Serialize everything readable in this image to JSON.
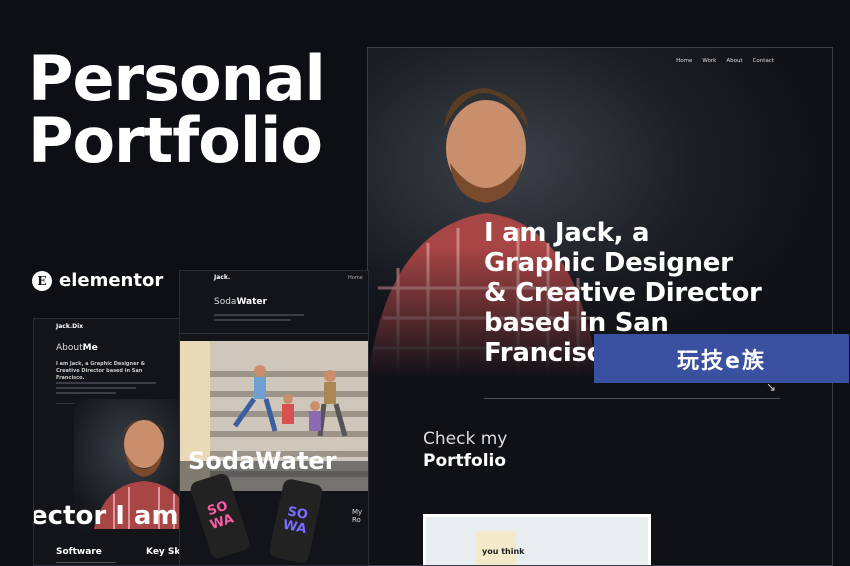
{
  "headline": {
    "line1": "Personal",
    "line2": "Portfolio"
  },
  "elementor": {
    "icon_glyph": "E",
    "label": "elementor"
  },
  "card_about": {
    "logo": "Jack.Dix",
    "title_light": "About",
    "title_bold": "Me",
    "blurb": "I am Jack, a Graphic Designer & Creative Director based in San Francisco.",
    "ghost_text": "ector I am",
    "section_left": "Software",
    "section_right": "Key Sk"
  },
  "card_soda": {
    "logo": "Jack.",
    "nav_home": "Home",
    "title_light": "Soda",
    "title_bold": "Water",
    "ghost_text": "SodaWater",
    "can_text_1": "SO WA",
    "can_text_2": "SO WA",
    "side_label": "My Ro"
  },
  "main": {
    "nav": [
      "Home",
      "Work",
      "About",
      "Contact"
    ],
    "hero": [
      "I am Jack, a",
      "Graphic Designer",
      "& Creative Director",
      "based in San",
      "Francisco"
    ],
    "arrow": "↘",
    "check_light": "Check my",
    "check_bold": "Portfolio",
    "thumb_text": "you think"
  },
  "watermark": "玩技e族"
}
